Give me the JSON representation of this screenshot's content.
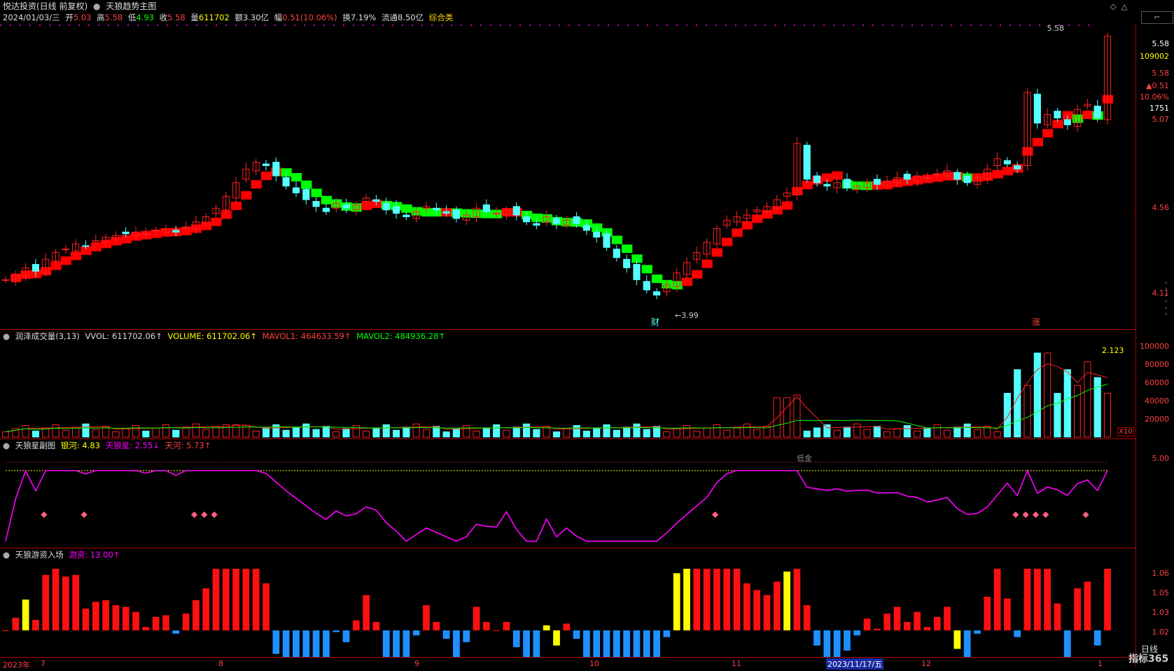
{
  "top_bar": {
    "app_title": "悦达投资(日线 前复权)",
    "indicator": "天狼趋势主图",
    "date": "2024/01/03/三",
    "open_label": "开",
    "open": "5.03",
    "high_label": "高",
    "high": "5.58",
    "low_label": "低",
    "low": "4.93",
    "close_label": "收",
    "close": "5.58",
    "vol_label": "量",
    "vol": "611702",
    "amt_label": "额",
    "amt": "3.30亿",
    "chg_label": "幅",
    "chg": "0.51(10.06%)",
    "turn_label": "换",
    "turn": "7.19%",
    "float_label": "流通",
    "float": "8.50亿",
    "sector": "综合类"
  },
  "main_chart": {
    "price_axis": [
      "5.58",
      "5.07",
      "4.56",
      "4.11"
    ],
    "right_stats": [
      "5.58",
      "109002",
      "5.58",
      "▲0.51",
      "10.06%",
      "1751",
      "5.07"
    ],
    "hi_label": "5.58",
    "lo_label": "3.99",
    "marker_cai": "财",
    "marker_zhang": "涨",
    "colors": {
      "up": "#ff2020",
      "down": "#54ffff",
      "ribbon_up": "#ff0000",
      "ribbon_down": "#00ff00"
    }
  },
  "vol_panel": {
    "title": "润泽成交量(3,13)",
    "vvol": "VVOL: 611702.06↑",
    "volume": "VOLUME: 611702.06↑",
    "mavol1": "MAVOL1: 464633.59↑",
    "mavol2": "MAVOL2: 484936.28↑",
    "ratio": "2.123",
    "axis": [
      "100000",
      "80000",
      "60000",
      "40000",
      "20000"
    ],
    "unit": "X10"
  },
  "star_panel": {
    "title": "天狼星副图",
    "yinhe": "银河: 4.83",
    "tianlang": "天狼星: 2.55↓",
    "tianhe": "天河: 5.73↑",
    "low_text": "低金",
    "axis": [
      "5.00"
    ]
  },
  "fund_panel": {
    "title": "天狼游资入场",
    "youzi": "游资: 13.00↑",
    "axis": [
      "1.06",
      "1.05",
      "1.03",
      "1.02"
    ]
  },
  "time_axis": {
    "labels": [
      "2023年",
      "7",
      "8",
      "9",
      "10",
      "11",
      "12",
      "1"
    ],
    "cursor_date": "2023/11/17/五"
  },
  "side_tab": "日线",
  "watermark": "指标365",
  "chart_data": {
    "type": "candlestick",
    "title": "悦达投资(日线 前复权)",
    "ohlc_close_series": [
      4.15,
      4.18,
      4.22,
      4.2,
      4.27,
      4.31,
      4.33,
      4.36,
      4.35,
      4.38,
      4.4,
      4.41,
      4.42,
      4.43,
      4.42,
      4.44,
      4.45,
      4.43,
      4.46,
      4.49,
      4.52,
      4.57,
      4.64,
      4.72,
      4.8,
      4.84,
      4.82,
      4.76,
      4.7,
      4.66,
      4.62,
      4.58,
      4.55,
      4.6,
      4.57,
      4.59,
      4.63,
      4.61,
      4.56,
      4.54,
      4.52,
      4.55,
      4.58,
      4.56,
      4.54,
      4.51,
      4.53,
      4.57,
      4.55,
      4.54,
      4.56,
      4.53,
      4.49,
      4.47,
      4.52,
      4.48,
      4.5,
      4.48,
      4.44,
      4.4,
      4.34,
      4.28,
      4.22,
      4.15,
      4.09,
      4.06,
      4.12,
      4.19,
      4.25,
      4.31,
      4.37,
      4.45,
      4.5,
      4.52,
      4.53,
      4.56,
      4.58,
      4.62,
      4.66,
      4.95,
      4.74,
      4.72,
      4.7,
      4.72,
      4.69,
      4.7,
      4.72,
      4.71,
      4.73,
      4.75,
      4.74,
      4.76,
      4.75,
      4.77,
      4.79,
      4.74,
      4.72,
      4.75,
      4.8,
      4.86,
      4.83,
      4.8,
      5.25,
      5.07,
      5.12,
      5.1,
      5.06,
      5.15,
      5.18,
      5.1,
      5.58
    ]
  }
}
